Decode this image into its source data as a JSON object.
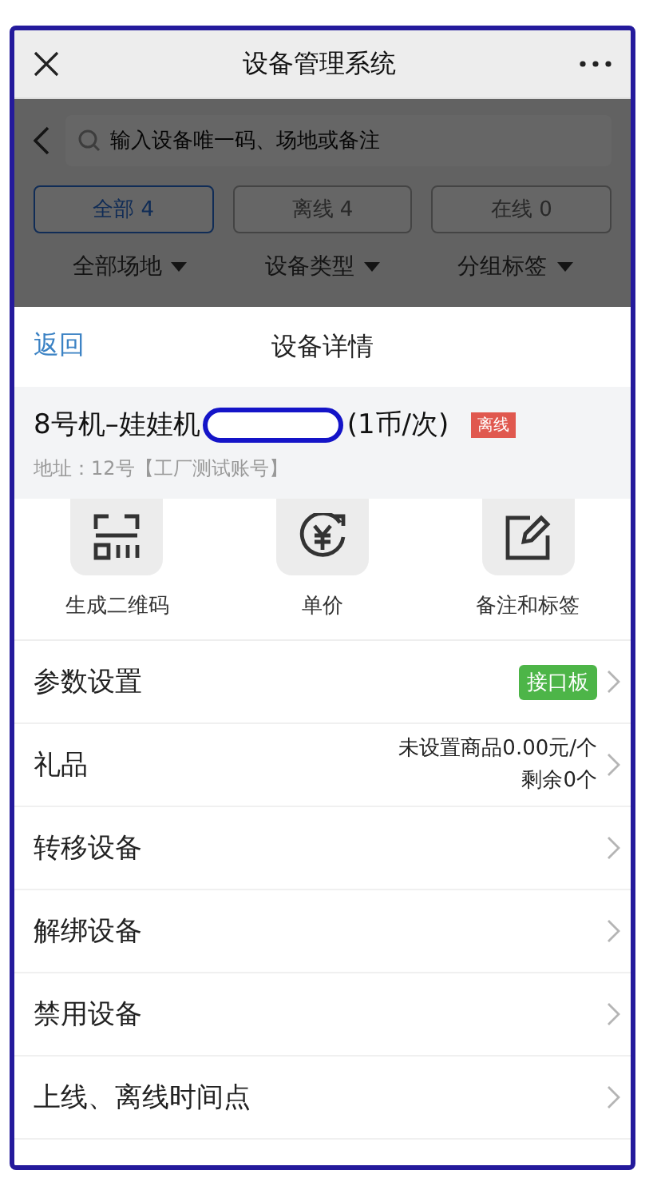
{
  "top_bar": {
    "title": "设备管理系统"
  },
  "background_page": {
    "search": {
      "placeholder": "输入设备唯一码、场地或备注"
    },
    "status_tabs": [
      {
        "label": "全部 4",
        "selected": true
      },
      {
        "label": "离线 4",
        "selected": false
      },
      {
        "label": "在线 0",
        "selected": false
      }
    ],
    "filters": [
      "全部场地",
      "设备类型",
      "分组标签"
    ]
  },
  "sheet": {
    "back": "返回",
    "title": "设备详情",
    "device": {
      "name": "8号机–娃娃机",
      "price": "(1币/次)",
      "status": "离线",
      "online": false,
      "address": "地址：12号【工厂测试账号】"
    },
    "actions": [
      {
        "label": "生成二维码",
        "kind": "qr"
      },
      {
        "label": "单价",
        "kind": "price"
      },
      {
        "label": "备注和标签",
        "kind": "edit"
      }
    ],
    "settings": [
      {
        "label": "参数设置",
        "tag": "接口板"
      },
      {
        "label": "礼品",
        "detail": [
          "未设置商品0.00元/个",
          "剩余0个"
        ]
      },
      {
        "label": "转移设备"
      },
      {
        "label": "解绑设备"
      },
      {
        "label": "禁用设备"
      },
      {
        "label": "上线、离线时间点"
      }
    ]
  }
}
